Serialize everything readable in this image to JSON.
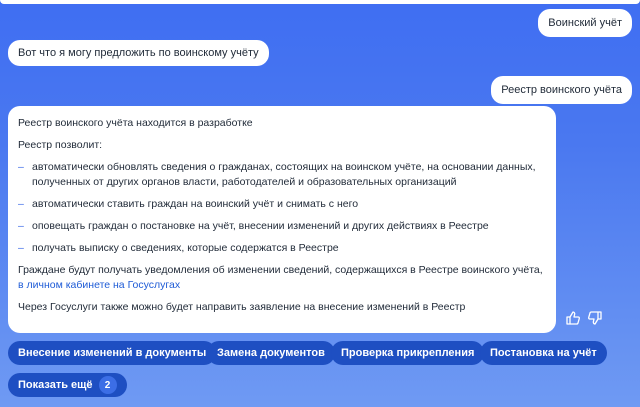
{
  "chat": {
    "user_msg_1": "Воинский учёт",
    "bot_msg_1": "Вот что я могу предложить по воинскому учёту",
    "user_msg_2": "Реестр воинского учёта",
    "bot_main": {
      "intro": "Реестр воинского учёта находится в разработке",
      "list_title": "Реестр позволит:",
      "items": [
        "автоматически обновлять сведения о гражданах, состоящих на воинском учёте, на основании данных, полученных от других органов власти, работодателей и образовательных организаций",
        "автоматически ставить граждан на воинский учёт и снимать с него",
        "оповещать граждан о постановке на учёт, внесении изменений и других действиях в Реестре",
        "получать выписку о сведениях, которые содержатся в Реестре"
      ],
      "notice_text": "Граждане будут получать уведомления об изменении сведений, содержащихся в Реестре воинского учёта,",
      "notice_link": "в личном кабинете на Госуслугах",
      "footer": "Через Госуслуги также можно будет направить заявление на внесение изменений в Реестр"
    }
  },
  "feedback": {
    "like_icon": "thumbs-up-icon",
    "dislike_icon": "thumbs-down-icon"
  },
  "chips": [
    "Внесение изменений в документы",
    "Замена документов",
    "Проверка прикрепления",
    "Постановка на учёт"
  ],
  "show_more": {
    "label": "Показать ещё",
    "count": "2"
  },
  "colors": {
    "background": "#3f6ef2",
    "chip": "#1e4fc2",
    "link": "#1e5bd6"
  }
}
